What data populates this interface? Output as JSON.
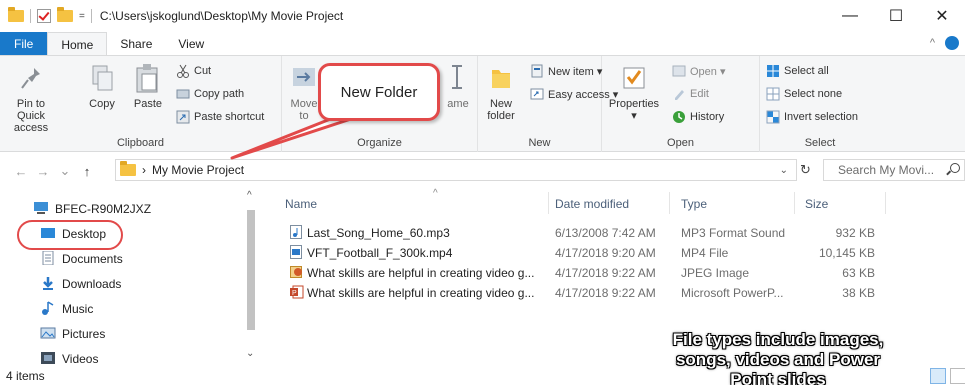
{
  "window": {
    "path": "C:\\Users\\jskoglund\\Desktop\\My Movie Project",
    "qa_dropdown": "=",
    "minimize": "—",
    "maximize": "☐",
    "close": "✕"
  },
  "tabs": [
    {
      "label": "File"
    },
    {
      "label": "Home"
    },
    {
      "label": "Share"
    },
    {
      "label": "View"
    }
  ],
  "ribbon": {
    "clipboard": {
      "label": "Clipboard",
      "pin_line1": "Pin to Quick",
      "pin_line2": "access",
      "copy": "Copy",
      "paste": "Paste",
      "cut": "Cut",
      "copy_path": "Copy path",
      "paste_shortcut": "Paste shortcut"
    },
    "organize": {
      "label": "Organize",
      "move_line1": "Move",
      "move_line2": "to",
      "rename": "ame"
    },
    "new": {
      "label": "New",
      "new_item": "New item ▾",
      "easy_access": "Easy access ▾",
      "new_folder_line1": "New",
      "new_folder_line2": "folder"
    },
    "open": {
      "label": "Open",
      "properties": "Properties",
      "properties_drop": "▾",
      "open": "Open ▾",
      "edit": "Edit",
      "history": "History"
    },
    "select": {
      "label": "Select",
      "select_all": "Select all",
      "select_none": "Select none",
      "invert": "Invert selection"
    }
  },
  "address": {
    "back": "←",
    "forward": "→",
    "recent": "⌄",
    "up": "↑",
    "sep": "›",
    "crumb": "My Movie Project",
    "drop": "⌄",
    "refresh": "↻",
    "search_placeholder": "Search My Movi..."
  },
  "nav": {
    "items": [
      {
        "label": "BFEC-R90M2JXZ"
      },
      {
        "label": "Desktop"
      },
      {
        "label": "Documents"
      },
      {
        "label": "Downloads"
      },
      {
        "label": "Music"
      },
      {
        "label": "Pictures"
      },
      {
        "label": "Videos"
      }
    ],
    "scroll_up": "^",
    "scroll_down": "⌄"
  },
  "columns": {
    "name": "Name",
    "date": "Date modified",
    "type": "Type",
    "size": "Size",
    "sort_arrow": "^"
  },
  "files": [
    {
      "name": "Last_Song_Home_60.mp3",
      "date": "6/13/2008 7:42 AM",
      "type": "MP3 Format Sound",
      "size": "932 KB"
    },
    {
      "name": "VFT_Football_F_300k.mp4",
      "date": "4/17/2018 9:20 AM",
      "type": "MP4 File",
      "size": "10,145 KB"
    },
    {
      "name": "What skills are helpful in creating video g...",
      "date": "4/17/2018 9:22 AM",
      "type": "JPEG Image",
      "size": "63 KB"
    },
    {
      "name": "What skills are helpful in creating video g...",
      "date": "4/17/2018 9:22 AM",
      "type": "Microsoft PowerP...",
      "size": "38 KB"
    }
  ],
  "status": {
    "items": "4 items"
  },
  "callouts": {
    "new_folder": "New Folder",
    "note_line1": "File types include images,",
    "note_line2": "songs, videos and Power",
    "note_line3": "Point slides"
  },
  "colors": {
    "accent": "#1979ca",
    "callout": "#e24a4a",
    "folder": "#f5c242"
  }
}
